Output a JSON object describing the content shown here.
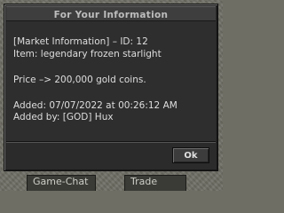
{
  "dialog": {
    "title": "For Your Information",
    "lines": [
      "[Market Information] – ID: 12",
      "Item: legendary frozen starlight",
      "Price –> 200,000 gold coins.",
      "Added: 07/07/2022 at 00:26:12 AM",
      "Added by: [GOD] Hux"
    ],
    "ok_label": "Ok"
  },
  "background": {
    "tabs": [
      "Game-Chat",
      "Trade"
    ]
  }
}
